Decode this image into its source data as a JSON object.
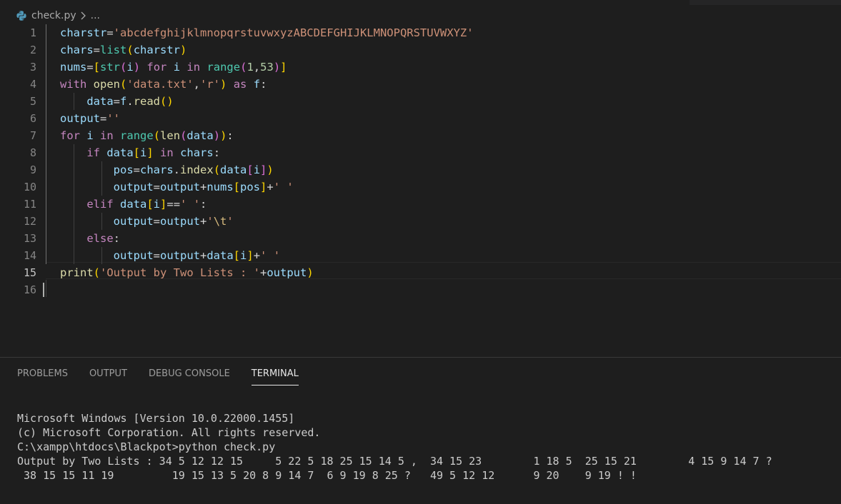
{
  "breadcrumb": {
    "file": "check.py",
    "more": "..."
  },
  "editor": {
    "line_numbers": [
      "1",
      "2",
      "3",
      "4",
      "5",
      "6",
      "7",
      "8",
      "9",
      "10",
      "11",
      "12",
      "13",
      "14",
      "15",
      "16"
    ],
    "tokens": {
      "l1": [
        "charstr",
        "=",
        "'abcdefghijklmnopqrstuvwxyzABCDEFGHIJKLMNOPQRSTUVWXYZ'"
      ],
      "l2": [
        "chars",
        "=",
        "list",
        "(",
        "charstr",
        ")"
      ],
      "l3": [
        "nums",
        "=",
        "[",
        "str",
        "(",
        "i",
        ")",
        " ",
        "for",
        " ",
        "i",
        " ",
        "in",
        " ",
        "range",
        "(",
        "1",
        ",",
        "53",
        ")",
        "]"
      ],
      "l4": [
        "with",
        " ",
        "open",
        "(",
        "'data.txt'",
        ",",
        "'r'",
        ")",
        " ",
        "as",
        " ",
        "f",
        ":"
      ],
      "l5": [
        "    ",
        "data",
        "=",
        "f",
        ".",
        "read",
        "(",
        ")"
      ],
      "l6": [
        "output",
        "=",
        "''"
      ],
      "l7": [
        "for",
        " ",
        "i",
        " ",
        "in",
        " ",
        "range",
        "(",
        "len",
        "(",
        "data",
        ")",
        ")",
        ":"
      ],
      "l8": [
        "    ",
        "if",
        " ",
        "data",
        "[",
        "i",
        "]",
        " ",
        "in",
        " ",
        "chars",
        ":"
      ],
      "l9": [
        "        ",
        "pos",
        "=",
        "chars",
        ".",
        "index",
        "(",
        "data",
        "[",
        "i",
        "]",
        ")"
      ],
      "l10": [
        "        ",
        "output",
        "=",
        "output",
        "+",
        "nums",
        "[",
        "pos",
        "]",
        "+",
        "' '"
      ],
      "l11": [
        "    ",
        "elif",
        " ",
        "data",
        "[",
        "i",
        "]",
        "==",
        "' '",
        ":"
      ],
      "l12": [
        "        ",
        "output",
        "=",
        "output",
        "+",
        "'",
        "\\t",
        "'"
      ],
      "l13": [
        "    ",
        "else",
        ":"
      ],
      "l14": [
        "        ",
        "output",
        "=",
        "output",
        "+",
        "data",
        "[",
        "i",
        "]",
        "+",
        "' '"
      ],
      "l15": [
        "print",
        "(",
        "'Output by Two Lists : '",
        "+",
        "output",
        ")"
      ]
    }
  },
  "panel": {
    "tabs": [
      "PROBLEMS",
      "OUTPUT",
      "DEBUG CONSOLE",
      "TERMINAL"
    ],
    "active_tab": "TERMINAL"
  },
  "terminal": {
    "lines": [
      "Microsoft Windows [Version 10.0.22000.1455]",
      "(c) Microsoft Corporation. All rights reserved.",
      "",
      "C:\\xampp\\htdocs\\Blackpot>python check.py",
      "Output by Two Lists : 34 5 12 12 15     5 22 5 18 25 15 14 5 ,  34 15 23        1 18 5  25 15 21        4 15 9 14 7 ?",
      " 38 15 15 11 19         19 15 13 5 20 8 9 14 7  6 9 19 8 25 ?   49 5 12 12      9 20    9 19 ! !"
    ]
  },
  "colors": {
    "editor_bg": "#1e1e1e",
    "keyword": "#c586c0",
    "string": "#ce9178",
    "function": "#dcdcaa",
    "variable": "#9cdcfe",
    "number": "#b5cea8",
    "builtin_class": "#4ec9b0",
    "bracket_1": "#ffd700",
    "bracket_2": "#da70d6",
    "bracket_3": "#179fff"
  },
  "icons": {
    "file_type": "python-icon",
    "separator": "chevron-right-icon"
  }
}
